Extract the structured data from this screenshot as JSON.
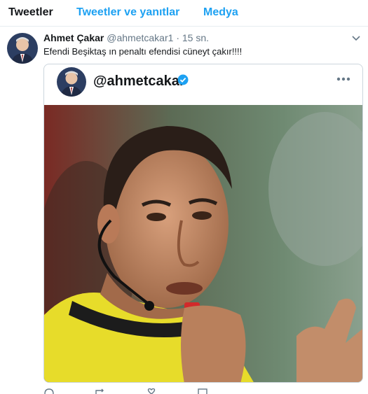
{
  "tabs": [
    {
      "label": "Tweetler",
      "active": true
    },
    {
      "label": "Tweetler ve yanıtlar",
      "active": false
    },
    {
      "label": "Medya",
      "active": false
    }
  ],
  "tweet": {
    "display_name": "Ahmet Çakar",
    "handle": "@ahmetcakar1",
    "separator": "·",
    "timestamp": "15 sn.",
    "text": "Efendi Beşiktaş ın penaltı efendisi cüneyt çakır!!!!",
    "card": {
      "handle": "@ahmetcakar",
      "verified": true
    }
  },
  "icons": {
    "more_menu": "chevron-down-icon",
    "card_more": "more-horizontal-icon",
    "verified": "verified-badge-icon",
    "actions": [
      "reply-icon",
      "retweet-icon",
      "like-icon",
      "message-icon"
    ]
  },
  "colors": {
    "accent": "#1da1f2",
    "text": "#14171a",
    "muted": "#657786",
    "border": "#e6ecf0"
  }
}
